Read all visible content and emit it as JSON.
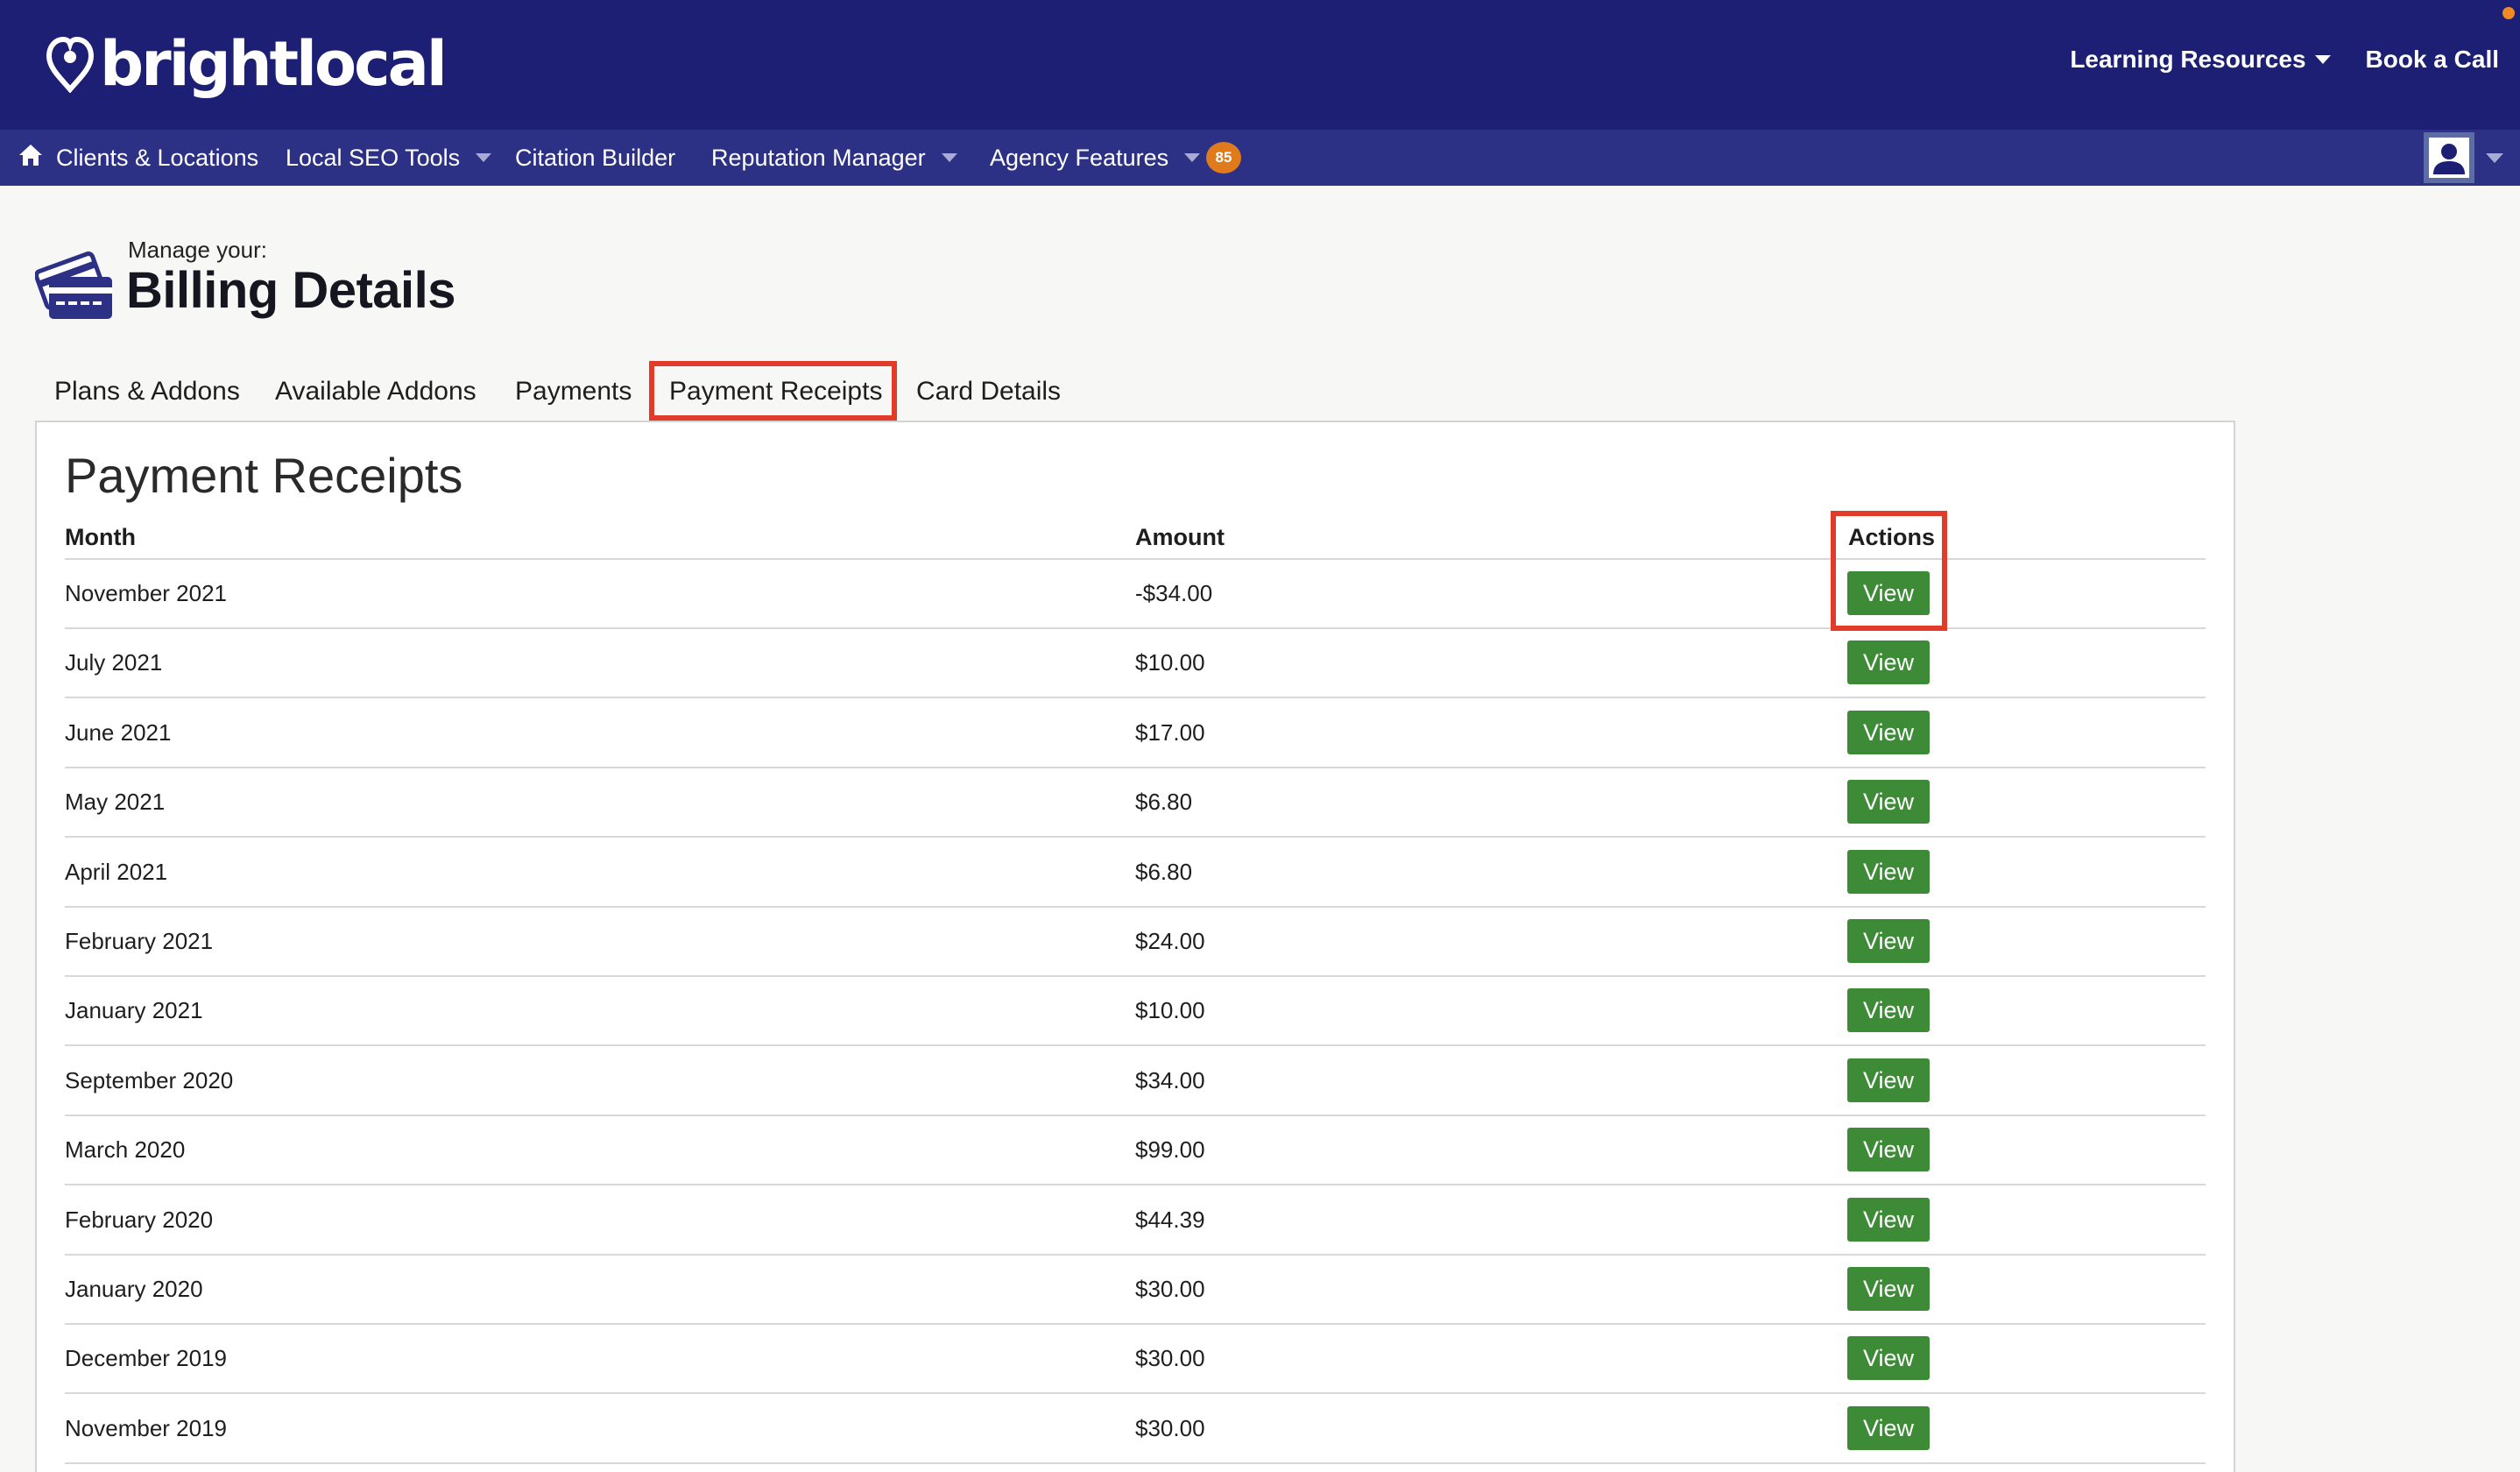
{
  "header": {
    "logo_text": "brightlocal",
    "links": [
      {
        "label": "Learning Resources",
        "has_dropdown": true
      },
      {
        "label": "Book a Call",
        "has_dropdown": false
      }
    ]
  },
  "nav": {
    "items": [
      {
        "label": "Clients & Locations",
        "icon": "home-icon",
        "has_dropdown": false
      },
      {
        "label": "Local SEO Tools",
        "has_dropdown": true
      },
      {
        "label": "Citation Builder",
        "has_dropdown": false
      },
      {
        "label": "Reputation Manager",
        "has_dropdown": true
      },
      {
        "label": "Agency Features",
        "has_dropdown": true
      }
    ],
    "badge_count": "85"
  },
  "page": {
    "subtitle": "Manage your:",
    "title": "Billing Details",
    "icon": "credit-cards-icon"
  },
  "tabs": [
    {
      "label": "Plans & Addons",
      "active": false
    },
    {
      "label": "Available Addons",
      "active": false
    },
    {
      "label": "Payments",
      "active": false
    },
    {
      "label": "Payment Receipts",
      "active": true
    },
    {
      "label": "Card Details",
      "active": false
    }
  ],
  "receipts": {
    "title": "Payment Receipts",
    "columns": {
      "month": "Month",
      "amount": "Amount",
      "actions": "Actions"
    },
    "button_label": "View",
    "rows": [
      {
        "month": "November 2021",
        "amount": "-$34.00"
      },
      {
        "month": "July 2021",
        "amount": "$10.00"
      },
      {
        "month": "June 2021",
        "amount": "$17.00"
      },
      {
        "month": "May 2021",
        "amount": "$6.80"
      },
      {
        "month": "April 2021",
        "amount": "$6.80"
      },
      {
        "month": "February 2021",
        "amount": "$24.00"
      },
      {
        "month": "January 2021",
        "amount": "$10.00"
      },
      {
        "month": "September 2020",
        "amount": "$34.00"
      },
      {
        "month": "March 2020",
        "amount": "$99.00"
      },
      {
        "month": "February 2020",
        "amount": "$44.39"
      },
      {
        "month": "January 2020",
        "amount": "$30.00"
      },
      {
        "month": "December 2019",
        "amount": "$30.00"
      },
      {
        "month": "November 2019",
        "amount": "$30.00"
      }
    ]
  },
  "colors": {
    "header_bg": "#1c1f73",
    "nav_bg": "#2d3185",
    "button_green": "#3d8b37",
    "highlight_red": "#e23b2a",
    "badge_orange": "#e07b1d"
  }
}
